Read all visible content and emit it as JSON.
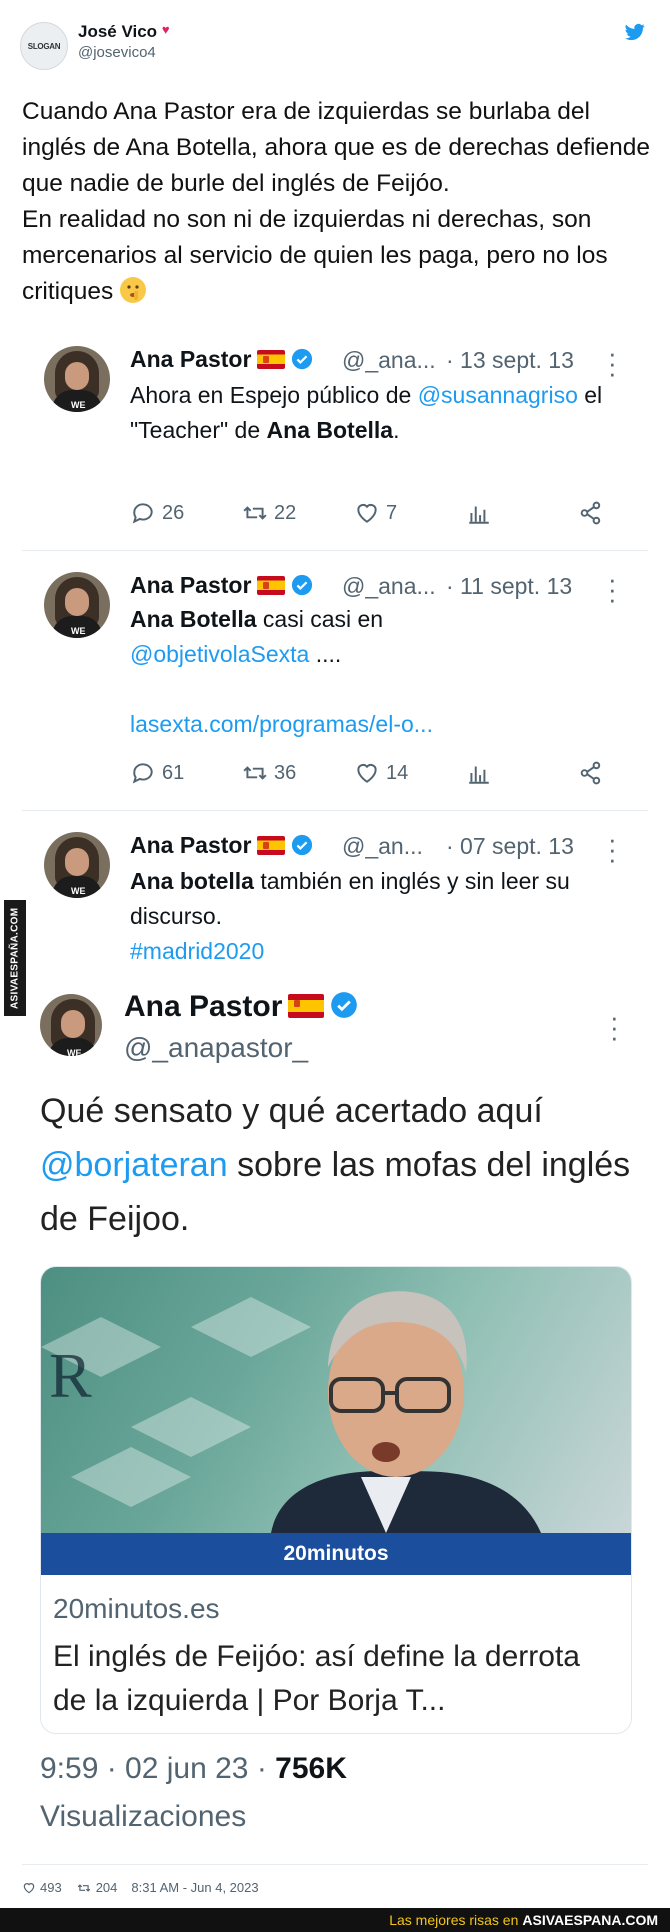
{
  "author": {
    "name": "José Vico",
    "handle": "@josevico4",
    "avatar_text": "SLOGAN"
  },
  "tweet_text_parts": [
    "Cuando Ana Pastor era de izquierdas se burlaba del inglés de Ana Botella, ahora que es de derechas defiende que nadie de burle del inglés de Feijóo.",
    "En realidad no son ni de izquierdas ni derechas, son mercenarios al servicio de quien les paga, pero no los critiques"
  ],
  "quoted": [
    {
      "name": "Ana Pastor",
      "handle": "@_ana...",
      "date": "· 13 sept. 13",
      "body": {
        "pre": "Ahora en Espejo público de ",
        "mention": "@susannagriso",
        "mid": " el \"Teacher\" de ",
        "bold": "Ana Botella",
        "post": "."
      },
      "stats": {
        "replies": "26",
        "retweets": "22",
        "likes": "7"
      }
    },
    {
      "name": "Ana Pastor",
      "handle": "@_ana...",
      "date": "· 11 sept. 13",
      "body": {
        "bold": "Ana Botella",
        "mid": " casi casi en",
        "mention": "@objetivolaSexta",
        "post": " ....",
        "link": "lasexta.com/programas/el-o..."
      },
      "stats": {
        "replies": "61",
        "retweets": "36",
        "likes": "14"
      }
    },
    {
      "name": "Ana Pastor",
      "handle": "@_an...",
      "date": "· 07 sept. 13",
      "body": {
        "bold": "Ana botella",
        "post": " también en inglés y sin leer su discurso.",
        "hashtag": "#madrid2020"
      }
    }
  ],
  "embedded": {
    "name": "Ana Pastor",
    "handle": "@_anapastor_",
    "text_pre": "Qué sensato y qué acertado aquí ",
    "mention": "@borjateran",
    "text_post": " sobre las mofas del inglés de Feijoo.",
    "card": {
      "banner": "20minutos",
      "domain": "20minutos.es",
      "title": "El inglés de Feijóo: así define la derrota de la izquierda | Por Borja T..."
    },
    "time": "9:59 · 02 jun 23 · ",
    "views_count": "756K",
    "views_label": "Visualizaciones"
  },
  "footer": {
    "likes": "493",
    "retweets": "204",
    "timestamp": "8:31 AM - Jun 4, 2023"
  },
  "watermark": {
    "side": "ASIVAESPAÑA.COM",
    "bottom_text": "Las mejores risas en",
    "bottom_brand": "ASIVAESPANA.COM"
  },
  "colors": {
    "link": "#1d9bf0",
    "muted": "#536471",
    "banner": "#1c4e9e"
  }
}
